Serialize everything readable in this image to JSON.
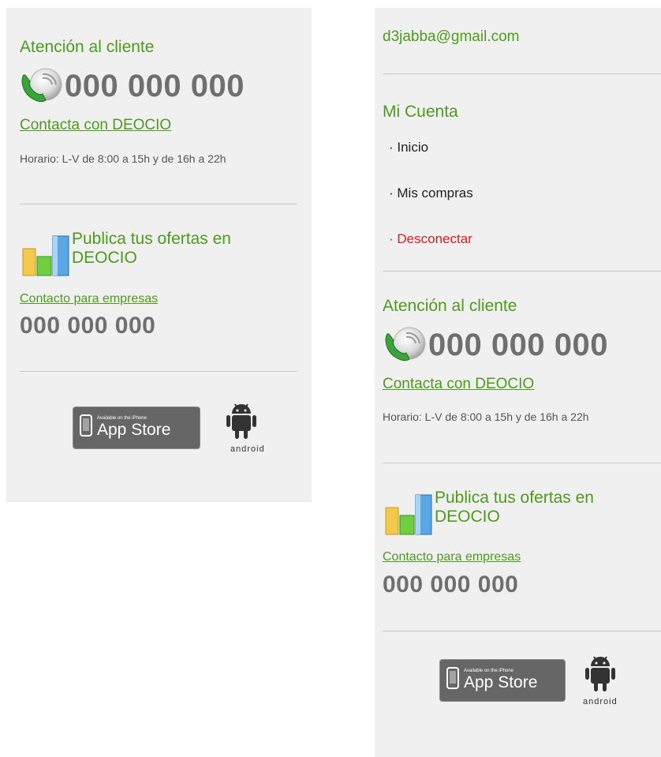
{
  "left": {
    "support_title": "Atención al cliente",
    "support_phone": "000 000 000",
    "contact_link": "Contacta con DEOCIO",
    "hours": "Horario: L-V de 8:00 a 15h y de 16h a 22h",
    "business_title": "Publica tus ofertas en DEOCIO",
    "business_link": "Contacto para empresas",
    "business_phone": "000 000 000",
    "appstore_small": "Available on the iPhone",
    "appstore_big": "App Store",
    "android_label": "android"
  },
  "right": {
    "email": "d3jabba@gmail.com",
    "account_title": "Mi Cuenta",
    "menu": [
      {
        "label": "· Inicio"
      },
      {
        "label": "· Mis compras"
      },
      {
        "label": "· Desconectar"
      }
    ],
    "support_title": "Atención al cliente",
    "support_phone": "000 000 000",
    "contact_link": "Contacta con DEOCIO",
    "hours": "Horario: L-V de 8:00 a 15h y de 16h a 22h",
    "business_title": "Publica tus ofertas en DEOCIO",
    "business_link": "Contacto para empresas",
    "business_phone": "000 000 000",
    "appstore_small": "Available on the iPhone",
    "appstore_big": "App Store",
    "android_label": "android"
  },
  "colors": {
    "accent_green": "#4e9a1c",
    "logout_red": "#e8161b",
    "panel_bg": "#f0f0f0",
    "phone_gray": "#6f6f6f"
  },
  "icons": [
    "phone-icon",
    "bar-chart-icon",
    "apple-iphone-icon",
    "android-robot-icon"
  ]
}
